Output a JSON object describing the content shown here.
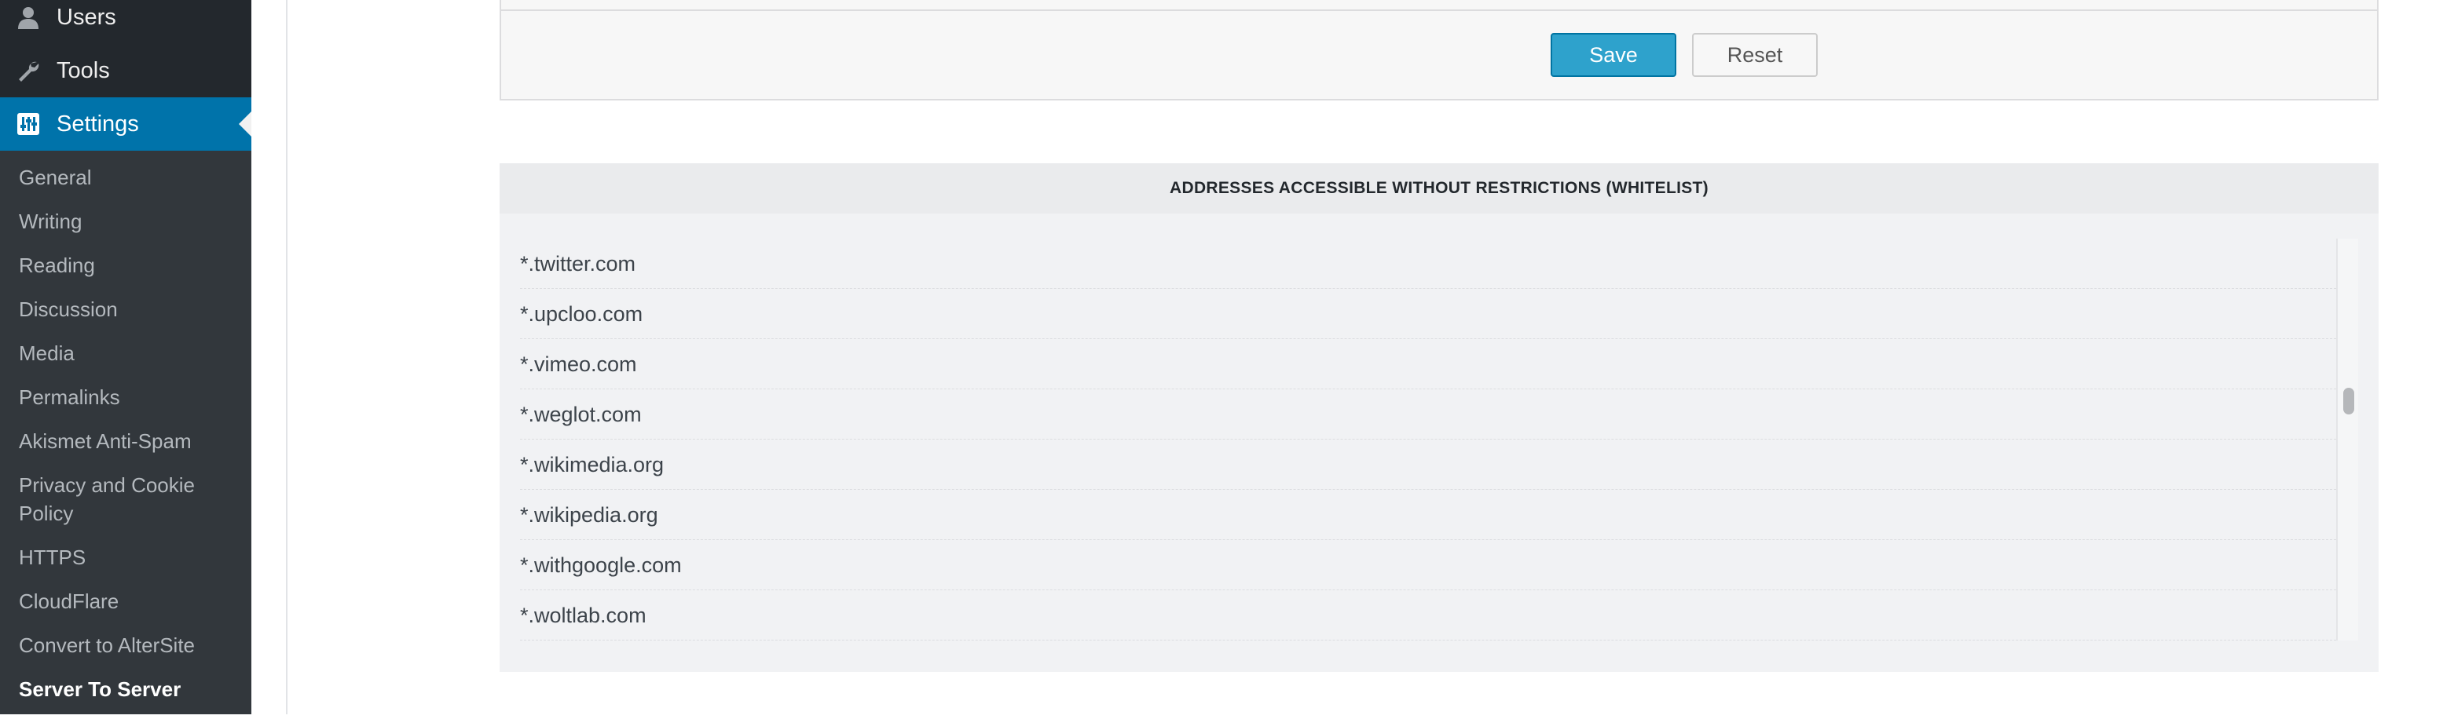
{
  "sidebar": {
    "menu": {
      "users": {
        "label": "Users",
        "icon": "user-icon"
      },
      "tools": {
        "label": "Tools",
        "icon": "wrench-icon"
      },
      "settings": {
        "label": "Settings",
        "icon": "settings-sliders-icon"
      }
    },
    "submenu": [
      "General",
      "Writing",
      "Reading",
      "Discussion",
      "Media",
      "Permalinks",
      "Akismet Anti-Spam",
      "Privacy and Cookie Policy",
      "HTTPS",
      "CloudFlare",
      "Convert to AlterSite",
      "Server To Server"
    ],
    "current_submenu": "Server To Server"
  },
  "actions": {
    "save_label": "Save",
    "reset_label": "Reset"
  },
  "whitelist": {
    "title": "ADDRESSES ACCESSIBLE WITHOUT RESTRICTIONS (WHITELIST)",
    "items": [
      "*.twitter.com",
      "*.upcloo.com",
      "*.vimeo.com",
      "*.weglot.com",
      "*.wikimedia.org",
      "*.wikipedia.org",
      "*.withgoogle.com",
      "*.woltlab.com"
    ]
  },
  "colors": {
    "sidebar_bg": "#32373c",
    "sidebar_top_bg": "#23282d",
    "accent": "#0073aa",
    "save_button": "#2ea2cc"
  }
}
